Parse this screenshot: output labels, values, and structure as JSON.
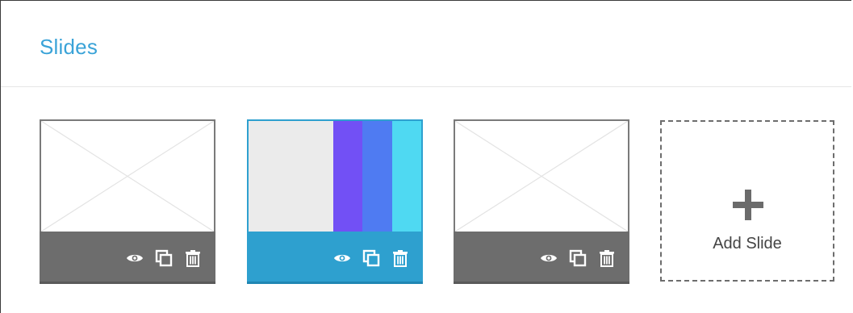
{
  "panel": {
    "title": "Slides"
  },
  "slides": [
    {
      "state": "placeholder",
      "active": false,
      "actions": [
        "eye-icon",
        "duplicate-icon",
        "trash-icon"
      ]
    },
    {
      "state": "colored",
      "active": true,
      "colors": [
        "#ebebeb",
        "#7250f5",
        "#4f7bf2",
        "#4fd9f2"
      ],
      "actions": [
        "eye-icon",
        "duplicate-icon",
        "trash-icon"
      ]
    },
    {
      "state": "placeholder",
      "active": false,
      "actions": [
        "eye-icon",
        "duplicate-icon",
        "trash-icon"
      ]
    }
  ],
  "add_slide": {
    "icon": "plus-icon",
    "label": "Add Slide"
  },
  "colors": {
    "accent": "#2ea0cf",
    "title": "#3aa3d8",
    "inactive_bar": "#6d6d6d"
  }
}
